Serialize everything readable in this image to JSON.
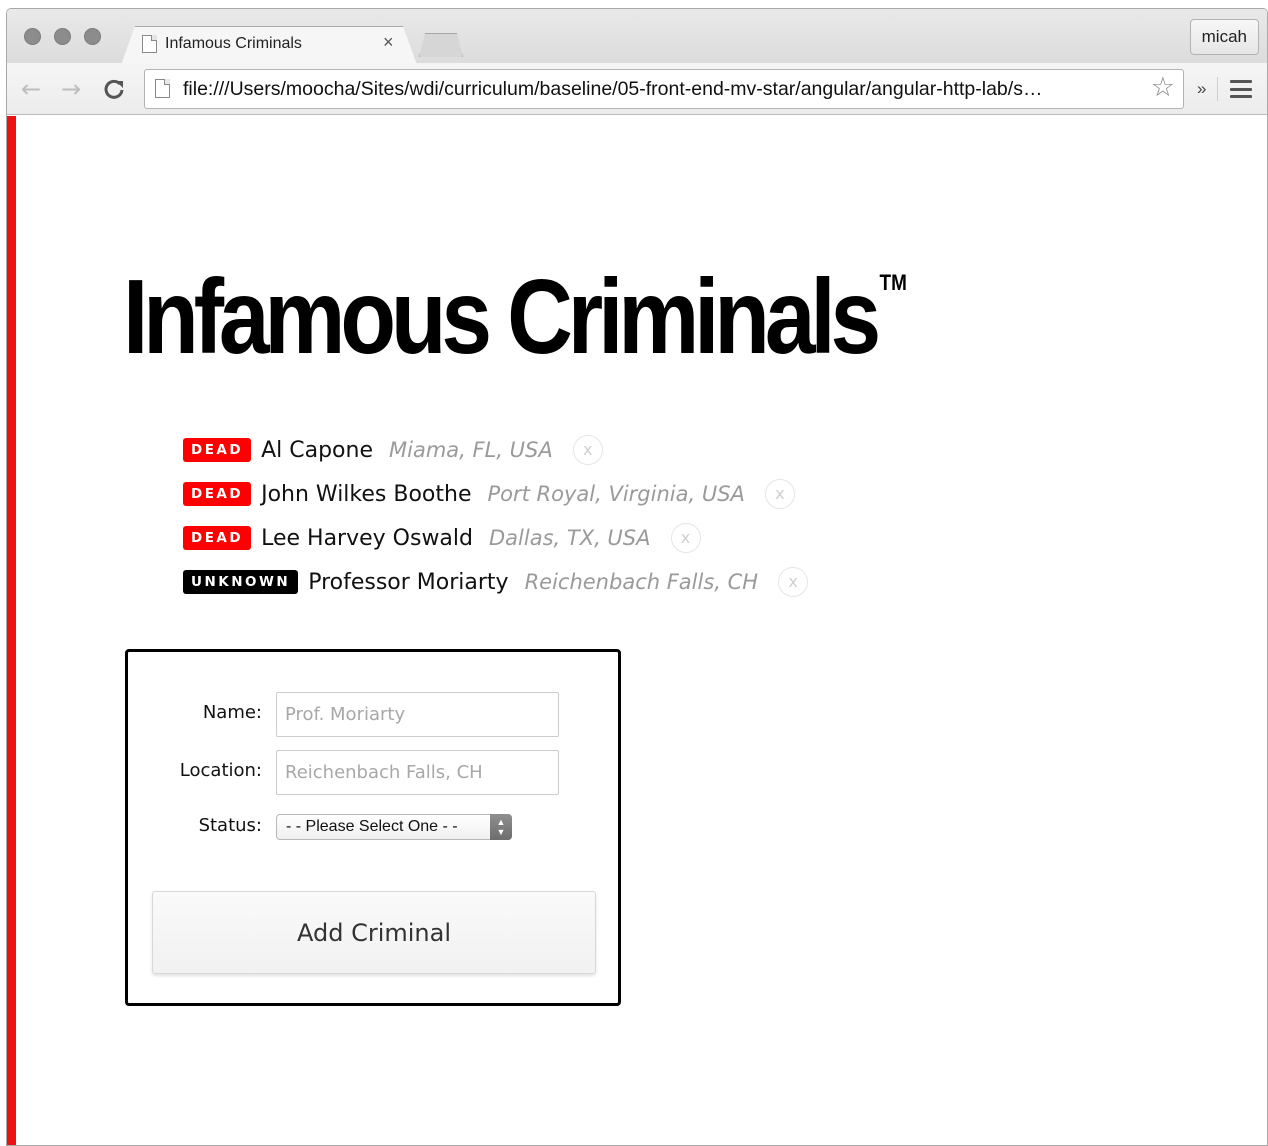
{
  "browser": {
    "tab_title": "Infamous Criminals",
    "tab_close": "×",
    "profile_name": "micah",
    "url": "file:///Users/moocha/Sites/wdi/curriculum/baseline/05-front-end-mv-star/angular/angular-http-lab/s…",
    "back_icon": "←",
    "forward_icon": "→",
    "reload_icon": "C",
    "star_icon": "☆",
    "extensions_chevron": "»"
  },
  "page": {
    "title": "Infamous Criminals",
    "trademark": "TM",
    "accent_color": "#ee1111"
  },
  "criminals": [
    {
      "status": "DEAD",
      "name": "Al Capone",
      "location": "Miama, FL, USA",
      "delete_label": "x"
    },
    {
      "status": "DEAD",
      "name": "John Wilkes Boothe",
      "location": "Port Royal, Virginia, USA",
      "delete_label": "x"
    },
    {
      "status": "DEAD",
      "name": "Lee Harvey Oswald",
      "location": "Dallas, TX, USA",
      "delete_label": "x"
    },
    {
      "status": "UNKNOWN",
      "name": "Professor Moriarty",
      "location": "Reichenbach Falls, CH",
      "delete_label": "x"
    }
  ],
  "form": {
    "name_label": "Name:",
    "name_placeholder": "Prof. Moriarty",
    "location_label": "Location:",
    "location_placeholder": "Reichenbach Falls, CH",
    "status_label": "Status:",
    "status_selected": "- - Please Select One - -",
    "submit_label": "Add Criminal"
  }
}
